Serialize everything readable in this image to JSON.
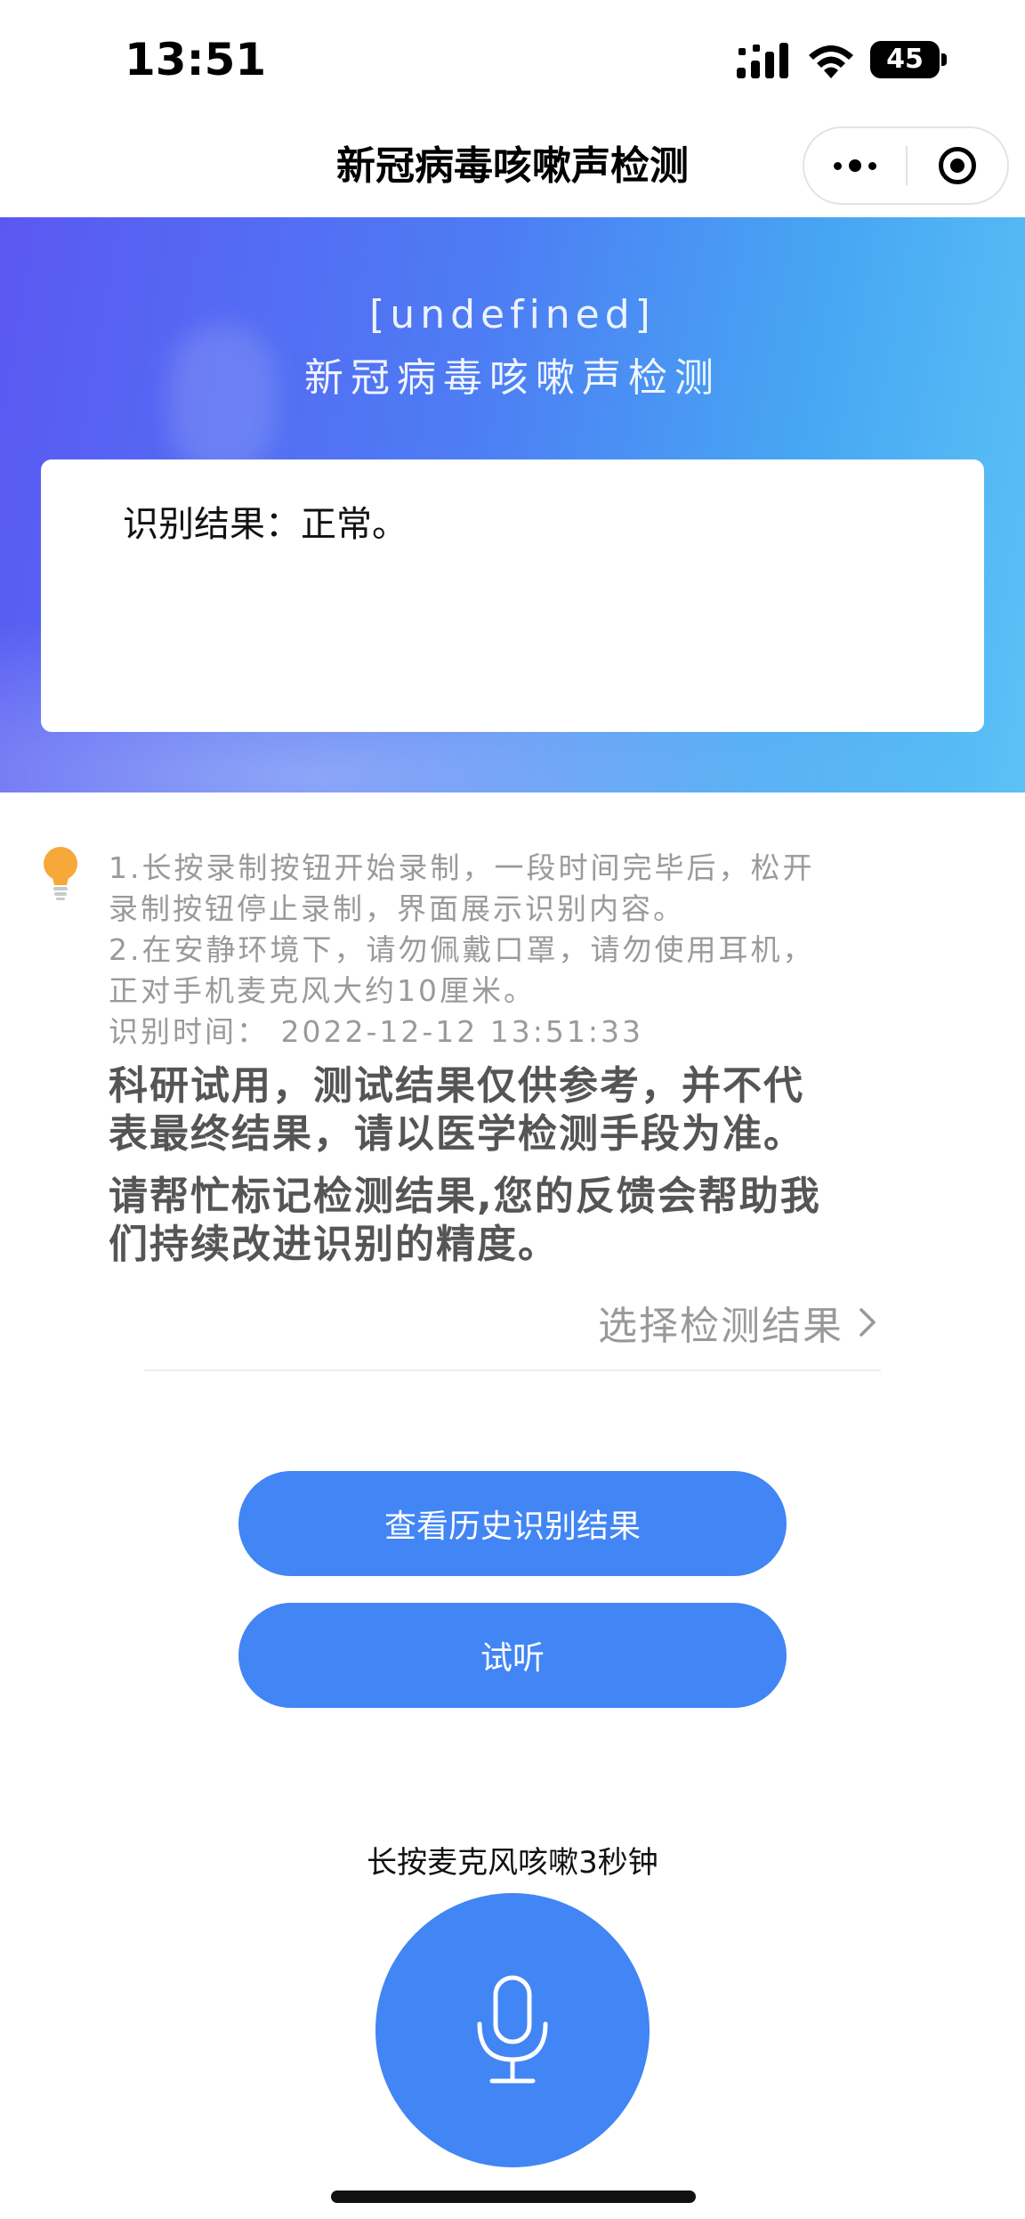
{
  "status_bar": {
    "time": "13:51",
    "battery_level": "45"
  },
  "nav": {
    "title": "新冠病毒咳嗽声检测",
    "menu_icon": "more-dots-icon",
    "close_icon": "target-close-icon"
  },
  "banner": {
    "line1": "[undefined]",
    "line2": "新冠病毒咳嗽声检测"
  },
  "result": {
    "text": "识别结果：正常。"
  },
  "instructions": {
    "icon": "lightbulb-icon",
    "line1": "1.长按录制按钮开始录制，一段时间完毕后，松开",
    "line2": "录制按钮停止录制，界面展示识别内容。",
    "line3": "2.在安静环境下，请勿佩戴口罩，请勿使用耳机，",
    "line4": "正对手机麦克风大约10厘米。",
    "time": "识别时间：  2022-12-12  13:51:33"
  },
  "notes": {
    "disclaimer_line1": "科研试用，测试结果仅供参考，并不代",
    "disclaimer_line2": "表最终结果，请以医学检测手段为准。",
    "feedback_line1": "请帮忙标记检测结果,您的反馈会帮助我",
    "feedback_line2": "们持续改进识别的精度。"
  },
  "select_result": {
    "label": "选择检测结果"
  },
  "buttons": {
    "history": "查看历史识别结果",
    "listen": "试听"
  },
  "record": {
    "hint": "长按麦克风咳嗽3秒钟",
    "icon": "microphone-icon"
  },
  "colors": {
    "primary_blue": "#4285f4",
    "banner_start": "#5b58f2",
    "banner_end": "#5cc2f5",
    "muted_text": "#9a9a9a"
  }
}
